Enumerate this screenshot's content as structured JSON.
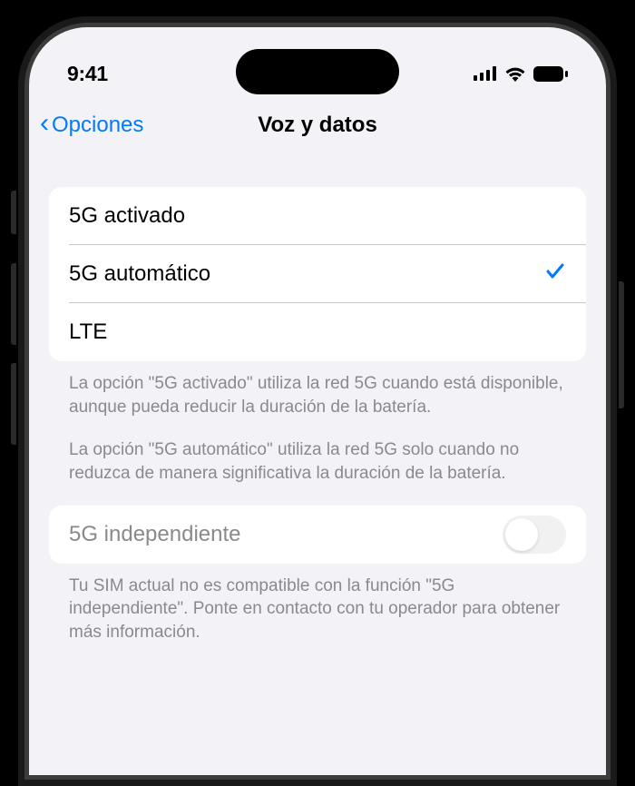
{
  "status": {
    "time": "9:41"
  },
  "nav": {
    "back_label": "Opciones",
    "title": "Voz y datos"
  },
  "options": [
    {
      "label": "5G activado",
      "selected": false
    },
    {
      "label": "5G automático",
      "selected": true
    },
    {
      "label": "LTE",
      "selected": false
    }
  ],
  "footer": {
    "p1": "La opción \"5G activado\" utiliza la red 5G cuando está disponible, aunque pueda reducir la duración de la batería.",
    "p2": "La opción \"5G automático\" utiliza la red 5G solo cuando no reduzca de manera significativa la duración de la batería."
  },
  "toggle": {
    "label": "5G independiente",
    "enabled": false,
    "disabled": true
  },
  "toggle_footer": "Tu SIM actual no es compatible con la función \"5G independiente\". Ponte en contacto con tu operador para obtener más información."
}
